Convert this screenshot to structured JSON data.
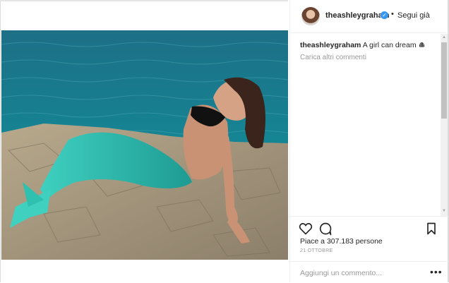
{
  "post": {
    "username": "theashleygraham",
    "verified": true,
    "separator": "•",
    "follow_label": "Segui già",
    "caption_user": "theashleygraham",
    "caption_text": "A girl can dream",
    "caption_emoji_icon": "shell-icon",
    "load_more_comments": "Carica altri commenti",
    "likes": "Piace a 307.183 persone",
    "date": "21 OTTOBRE",
    "comment_placeholder": "Aggiungi un commento...",
    "more_options": "•••"
  },
  "colors": {
    "verified_blue": "#3897f0",
    "text": "#262626",
    "secondary_text": "#999999",
    "sea": "#1f7f8f",
    "tail": "#2bb5a8"
  },
  "icons": {
    "like": "heart-icon",
    "comment": "comment-icon",
    "save": "bookmark-icon",
    "verified": "verified-badge-icon"
  }
}
